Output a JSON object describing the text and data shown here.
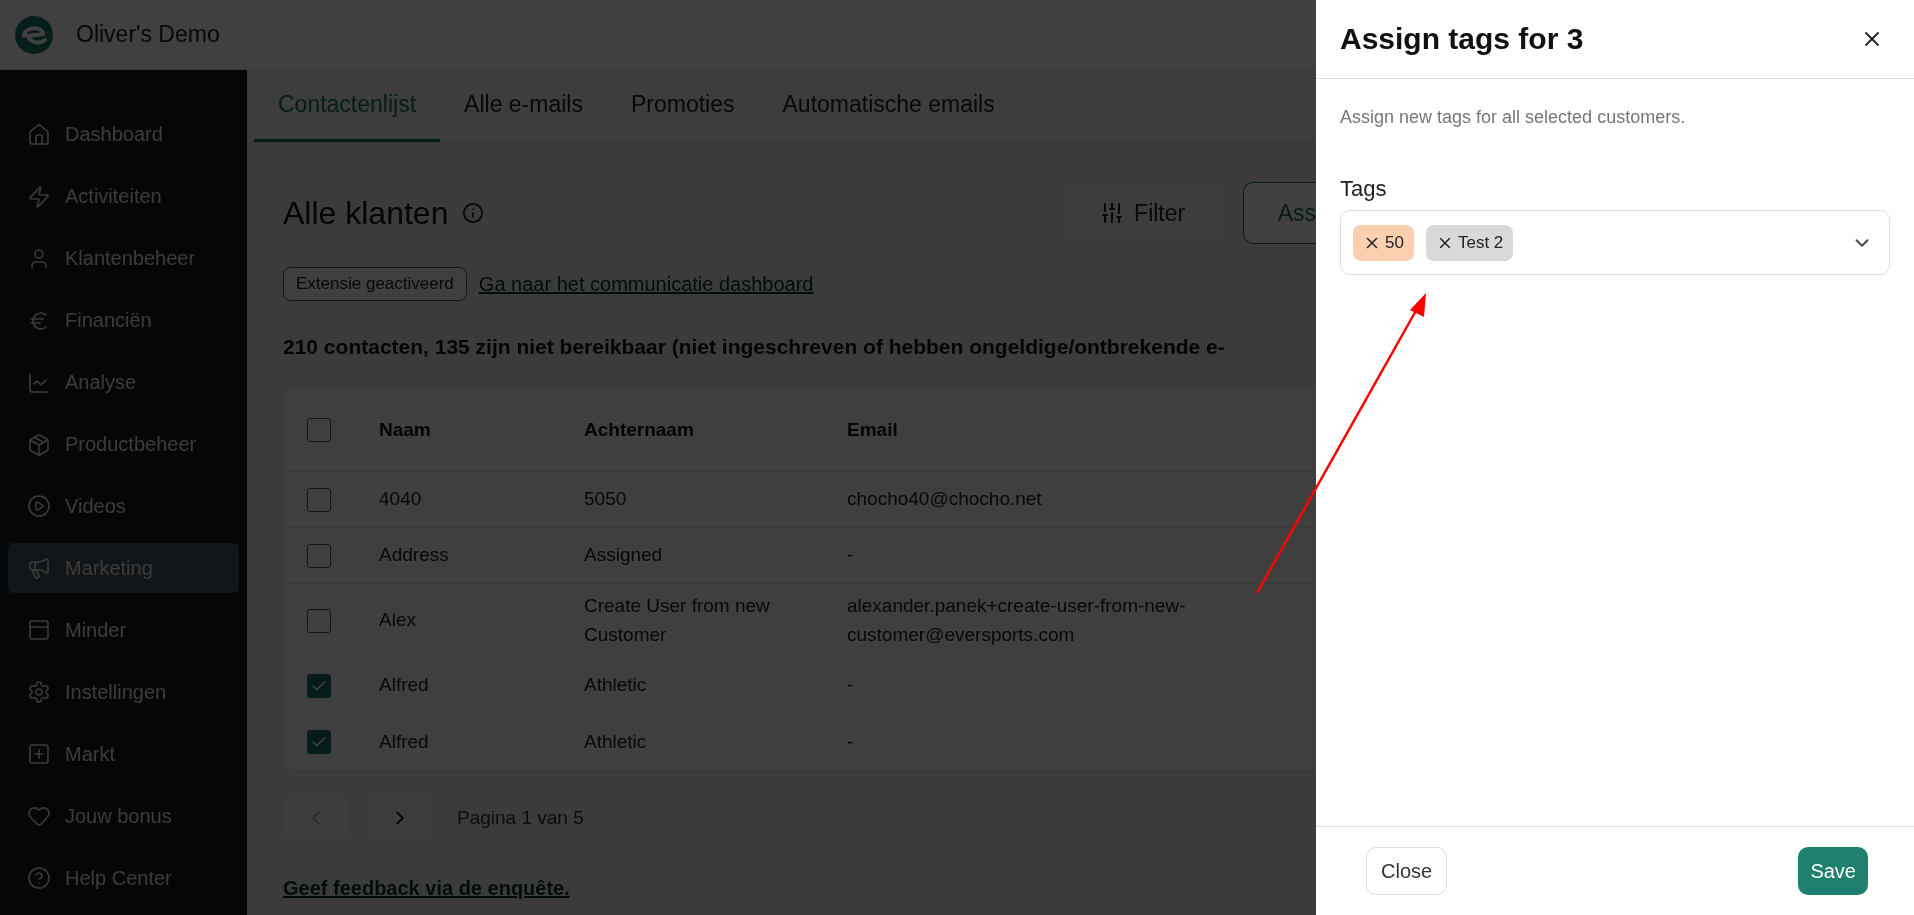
{
  "app": {
    "title": "Oliver's Demo"
  },
  "sidebar": {
    "items": [
      {
        "label": "Dashboard",
        "selected": false
      },
      {
        "label": "Activiteiten",
        "selected": false
      },
      {
        "label": "Klantenbeheer",
        "selected": false
      },
      {
        "label": "Financiën",
        "selected": false
      },
      {
        "label": "Analyse",
        "selected": false
      },
      {
        "label": "Productbeheer",
        "selected": false
      },
      {
        "label": "Videos",
        "selected": false
      },
      {
        "label": "Marketing",
        "selected": true
      },
      {
        "label": "Minder",
        "selected": false
      },
      {
        "label": "Instellingen",
        "selected": false
      },
      {
        "label": "Markt",
        "selected": false
      },
      {
        "label": "Jouw bonus",
        "selected": false
      },
      {
        "label": "Help Center",
        "selected": false
      }
    ]
  },
  "tabs": [
    {
      "label": "Contactenlijst",
      "selected": true
    },
    {
      "label": "Alle e-mails",
      "selected": false
    },
    {
      "label": "Promoties",
      "selected": false
    },
    {
      "label": "Automatische emails",
      "selected": false
    }
  ],
  "page": {
    "title": "Alle klanten",
    "buttons": [
      "Filter",
      "Ass"
    ],
    "badge": "Extensie geactiveerd",
    "link": "Ga naar het communicatie dashboard",
    "summary": "210 contacten, 135 zijn niet bereikbaar (niet ingeschreven of hebben ongeldige/ontbrekende e-"
  },
  "table": {
    "header_checked": false,
    "columns": [
      "Naam",
      "Achternaam",
      "Email"
    ],
    "rows": [
      {
        "checked": false,
        "cells": [
          "4040",
          "5050",
          "chocho40@chocho.net"
        ]
      },
      {
        "checked": false,
        "cells": [
          "Address",
          "Assigned",
          "-"
        ]
      },
      {
        "checked": false,
        "cells": [
          "Alex",
          "Create User from new Customer",
          "alexander.panek+create-user-from-new-customer@eversports.com"
        ]
      },
      {
        "checked": true,
        "cells": [
          "Alfred",
          "Athletic",
          "-"
        ]
      },
      {
        "checked": true,
        "cells": [
          "Alfred",
          "Athletic",
          "-"
        ]
      }
    ]
  },
  "pagination": {
    "prev_disabled": true,
    "next_disabled": false,
    "label": "Pagina 1 van 5"
  },
  "feedback_link": "Geef feedback via de enquête.",
  "drawer": {
    "title": "Assign tags for 3",
    "description": "Assign new tags for all selected customers.",
    "field_label": "Tags",
    "tags": [
      {
        "label": "50",
        "color": "#fbd0b0"
      },
      {
        "label": "Test 2",
        "color": "#d9d9d9"
      }
    ],
    "buttons": [
      "Close",
      "Save"
    ]
  }
}
